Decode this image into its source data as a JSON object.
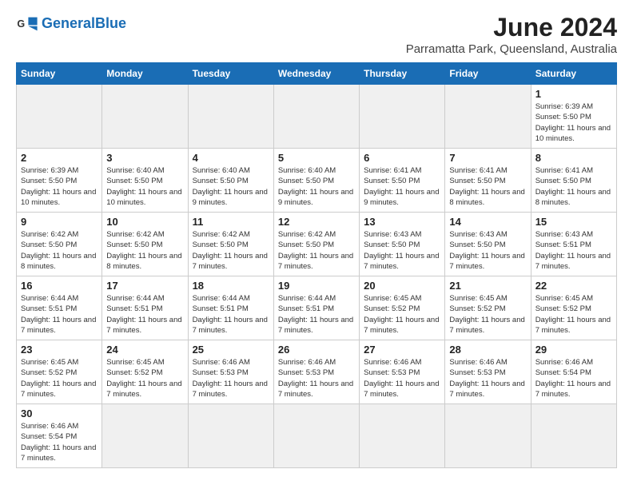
{
  "header": {
    "logo_general": "General",
    "logo_blue": "Blue",
    "title": "June 2024",
    "subtitle": "Parramatta Park, Queensland, Australia"
  },
  "days_of_week": [
    "Sunday",
    "Monday",
    "Tuesday",
    "Wednesday",
    "Thursday",
    "Friday",
    "Saturday"
  ],
  "weeks": [
    [
      {
        "day": "",
        "info": "",
        "empty": true
      },
      {
        "day": "",
        "info": "",
        "empty": true
      },
      {
        "day": "",
        "info": "",
        "empty": true
      },
      {
        "day": "",
        "info": "",
        "empty": true
      },
      {
        "day": "",
        "info": "",
        "empty": true
      },
      {
        "day": "",
        "info": "",
        "empty": true
      },
      {
        "day": "1",
        "info": "Sunrise: 6:39 AM\nSunset: 5:50 PM\nDaylight: 11 hours and 10 minutes."
      }
    ],
    [
      {
        "day": "2",
        "info": "Sunrise: 6:39 AM\nSunset: 5:50 PM\nDaylight: 11 hours and 10 minutes."
      },
      {
        "day": "3",
        "info": "Sunrise: 6:40 AM\nSunset: 5:50 PM\nDaylight: 11 hours and 10 minutes."
      },
      {
        "day": "4",
        "info": "Sunrise: 6:40 AM\nSunset: 5:50 PM\nDaylight: 11 hours and 9 minutes."
      },
      {
        "day": "5",
        "info": "Sunrise: 6:40 AM\nSunset: 5:50 PM\nDaylight: 11 hours and 9 minutes."
      },
      {
        "day": "6",
        "info": "Sunrise: 6:41 AM\nSunset: 5:50 PM\nDaylight: 11 hours and 9 minutes."
      },
      {
        "day": "7",
        "info": "Sunrise: 6:41 AM\nSunset: 5:50 PM\nDaylight: 11 hours and 8 minutes."
      },
      {
        "day": "8",
        "info": "Sunrise: 6:41 AM\nSunset: 5:50 PM\nDaylight: 11 hours and 8 minutes."
      }
    ],
    [
      {
        "day": "9",
        "info": "Sunrise: 6:42 AM\nSunset: 5:50 PM\nDaylight: 11 hours and 8 minutes."
      },
      {
        "day": "10",
        "info": "Sunrise: 6:42 AM\nSunset: 5:50 PM\nDaylight: 11 hours and 8 minutes."
      },
      {
        "day": "11",
        "info": "Sunrise: 6:42 AM\nSunset: 5:50 PM\nDaylight: 11 hours and 7 minutes."
      },
      {
        "day": "12",
        "info": "Sunrise: 6:42 AM\nSunset: 5:50 PM\nDaylight: 11 hours and 7 minutes."
      },
      {
        "day": "13",
        "info": "Sunrise: 6:43 AM\nSunset: 5:50 PM\nDaylight: 11 hours and 7 minutes."
      },
      {
        "day": "14",
        "info": "Sunrise: 6:43 AM\nSunset: 5:50 PM\nDaylight: 11 hours and 7 minutes."
      },
      {
        "day": "15",
        "info": "Sunrise: 6:43 AM\nSunset: 5:51 PM\nDaylight: 11 hours and 7 minutes."
      }
    ],
    [
      {
        "day": "16",
        "info": "Sunrise: 6:44 AM\nSunset: 5:51 PM\nDaylight: 11 hours and 7 minutes."
      },
      {
        "day": "17",
        "info": "Sunrise: 6:44 AM\nSunset: 5:51 PM\nDaylight: 11 hours and 7 minutes."
      },
      {
        "day": "18",
        "info": "Sunrise: 6:44 AM\nSunset: 5:51 PM\nDaylight: 11 hours and 7 minutes."
      },
      {
        "day": "19",
        "info": "Sunrise: 6:44 AM\nSunset: 5:51 PM\nDaylight: 11 hours and 7 minutes."
      },
      {
        "day": "20",
        "info": "Sunrise: 6:45 AM\nSunset: 5:52 PM\nDaylight: 11 hours and 7 minutes."
      },
      {
        "day": "21",
        "info": "Sunrise: 6:45 AM\nSunset: 5:52 PM\nDaylight: 11 hours and 7 minutes."
      },
      {
        "day": "22",
        "info": "Sunrise: 6:45 AM\nSunset: 5:52 PM\nDaylight: 11 hours and 7 minutes."
      }
    ],
    [
      {
        "day": "23",
        "info": "Sunrise: 6:45 AM\nSunset: 5:52 PM\nDaylight: 11 hours and 7 minutes."
      },
      {
        "day": "24",
        "info": "Sunrise: 6:45 AM\nSunset: 5:52 PM\nDaylight: 11 hours and 7 minutes."
      },
      {
        "day": "25",
        "info": "Sunrise: 6:46 AM\nSunset: 5:53 PM\nDaylight: 11 hours and 7 minutes."
      },
      {
        "day": "26",
        "info": "Sunrise: 6:46 AM\nSunset: 5:53 PM\nDaylight: 11 hours and 7 minutes."
      },
      {
        "day": "27",
        "info": "Sunrise: 6:46 AM\nSunset: 5:53 PM\nDaylight: 11 hours and 7 minutes."
      },
      {
        "day": "28",
        "info": "Sunrise: 6:46 AM\nSunset: 5:53 PM\nDaylight: 11 hours and 7 minutes."
      },
      {
        "day": "29",
        "info": "Sunrise: 6:46 AM\nSunset: 5:54 PM\nDaylight: 11 hours and 7 minutes."
      }
    ],
    [
      {
        "day": "30",
        "info": "Sunrise: 6:46 AM\nSunset: 5:54 PM\nDaylight: 11 hours and 7 minutes."
      },
      {
        "day": "",
        "info": "",
        "empty": true
      },
      {
        "day": "",
        "info": "",
        "empty": true
      },
      {
        "day": "",
        "info": "",
        "empty": true
      },
      {
        "day": "",
        "info": "",
        "empty": true
      },
      {
        "day": "",
        "info": "",
        "empty": true
      },
      {
        "day": "",
        "info": "",
        "empty": true
      }
    ]
  ]
}
